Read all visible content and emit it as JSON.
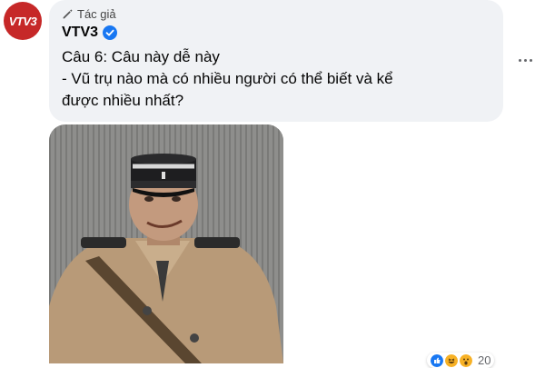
{
  "comment": {
    "author_tag": "Tác giả",
    "author": "VTV3",
    "avatar_logo": "VTV3",
    "lines": [
      "Câu 6: Câu này dễ này",
      "- Vũ trụ nào mà có nhiều người có thể biết và kể",
      "được nhiều nhất?"
    ],
    "reactions": {
      "icons": [
        "like-icon",
        "haha-icon",
        "wow-icon"
      ],
      "count": "20"
    }
  },
  "colors": {
    "bubble": "#f0f2f5",
    "verified": "#1877f2",
    "avatar": "#c62828"
  }
}
